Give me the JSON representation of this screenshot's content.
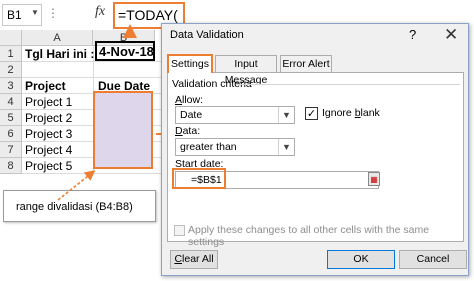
{
  "formula_bar": {
    "name_box": "B1",
    "fx": "fx",
    "formula": "=TODAY("
  },
  "sheet": {
    "columns": [
      "A",
      "B"
    ],
    "rows": [
      "1",
      "2",
      "3",
      "4",
      "5",
      "6",
      "7",
      "8"
    ],
    "a1": "Tgl Hari ini :",
    "b1": "4-Nov-18",
    "a3": "Project",
    "b3": "Due Date",
    "projects": [
      "Project 1",
      "Project 2",
      "Project 3",
      "Project 4",
      "Project 5"
    ]
  },
  "callout": {
    "text": "range divalidasi  (B4:B8)"
  },
  "dialog": {
    "title": "Data Validation",
    "help": "?",
    "close": "✕",
    "tabs": [
      "Settings",
      "Input Message",
      "Error Alert"
    ],
    "criteria_label": "Validation criteria",
    "allow_label_u": "A",
    "allow_label_rest": "llow:",
    "allow_value": "Date",
    "ignore_blank_pre": "Ignore ",
    "ignore_blank_u": "b",
    "ignore_blank_post": "lank",
    "ignore_blank_checked": true,
    "data_label_u": "D",
    "data_label_rest": "ata:",
    "data_value": "greater than",
    "start_label_u": "S",
    "start_label_rest": "tart date:",
    "start_value": "=$B$1",
    "apply_label": "Apply these changes to all other cells with the same settings",
    "clear_all_u": "C",
    "clear_all_rest": "lear All",
    "ok_label": "OK",
    "cancel_label": "Cancel"
  },
  "colors": {
    "accent": "#ed7d31",
    "range_fill": "#ded6ea",
    "dialog_bg": "#f0f0f0"
  }
}
